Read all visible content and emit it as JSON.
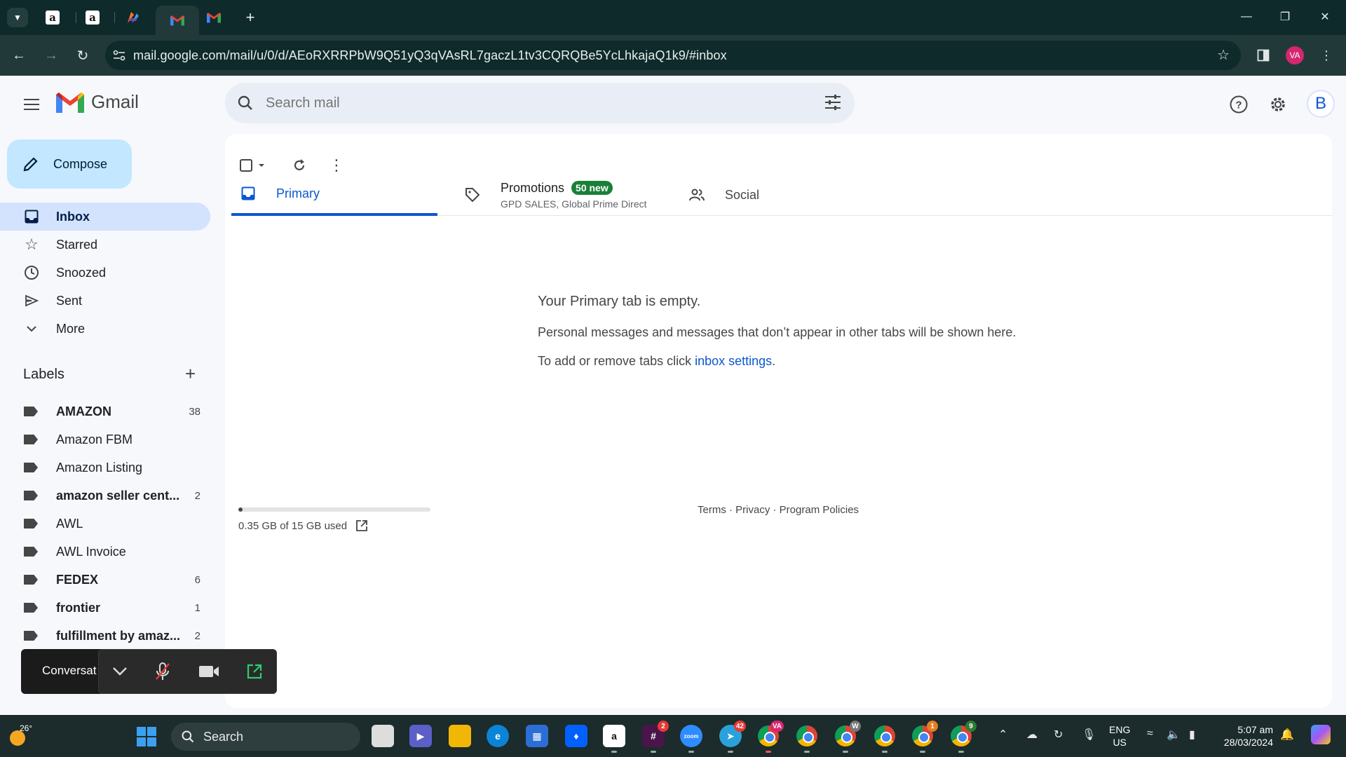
{
  "browser": {
    "url": "mail.google.com/mail/u/0/d/AEoRXRRPbW9Q51yQ3qVAsRL7gaczL1tv3CQRQBe5YcLhkajaQ1k9/#inbox",
    "profile_initials": "VA",
    "tabs": [
      {
        "icon": "amazon-icon",
        "glyph": "a"
      },
      {
        "icon": "amazon-icon",
        "glyph": "a"
      },
      {
        "icon": "pen-app-icon",
        "glyph": ""
      },
      {
        "icon": "gmail-icon",
        "glyph": "M",
        "active": true
      },
      {
        "icon": "gmail-icon",
        "glyph": "M"
      }
    ]
  },
  "gmail": {
    "logo_text": "Gmail",
    "search_placeholder": "Search mail",
    "account_initial": "B",
    "compose_label": "Compose",
    "nav": [
      {
        "label": "Inbox",
        "icon": "inbox-icon",
        "active": true
      },
      {
        "label": "Starred",
        "icon": "star-icon"
      },
      {
        "label": "Snoozed",
        "icon": "clock-icon"
      },
      {
        "label": "Sent",
        "icon": "send-icon"
      },
      {
        "label": "More",
        "icon": "chevron-down-icon"
      }
    ],
    "labels_title": "Labels",
    "labels": [
      {
        "name": "AMAZON",
        "count": "38",
        "bold": true
      },
      {
        "name": "Amazon FBM",
        "count": "",
        "bold": false
      },
      {
        "name": "Amazon Listing",
        "count": "",
        "bold": false
      },
      {
        "name": "amazon seller cent...",
        "count": "2",
        "bold": true
      },
      {
        "name": "AWL",
        "count": "",
        "bold": false
      },
      {
        "name": "AWL Invoice",
        "count": "",
        "bold": false
      },
      {
        "name": "FEDEX",
        "count": "6",
        "bold": true
      },
      {
        "name": "frontier",
        "count": "1",
        "bold": true
      },
      {
        "name": "fulfillment by amaz...",
        "count": "2",
        "bold": true
      }
    ],
    "tabs": {
      "primary": "Primary",
      "promotions": "Promotions",
      "promotions_badge": "50 new",
      "promotions_sub": "GPD SALES, Global Prime Direct",
      "social": "Social"
    },
    "empty": {
      "title": "Your Primary tab is empty.",
      "line1": "Personal messages and messages that don’t appear in other tabs will be shown here.",
      "line2_prefix": "To add or remove tabs click ",
      "line2_link": "inbox settings",
      "line2_suffix": "."
    },
    "storage": {
      "text": "0.35 GB of 15 GB used",
      "fraction": 0.023
    },
    "footer": "Terms · Privacy · Program Policies",
    "conversation_text": "Conversat"
  },
  "taskbar": {
    "temperature": "26°",
    "search_label": "Search",
    "lang_line1": "ENG",
    "lang_line2": "US",
    "time": "5:07 am",
    "date": "28/03/2024",
    "badges": {
      "slack": "2",
      "telegram": "42",
      "chrome_va": "VA",
      "chrome_w": "W",
      "chrome_1": "1",
      "chrome_9": "9"
    }
  }
}
